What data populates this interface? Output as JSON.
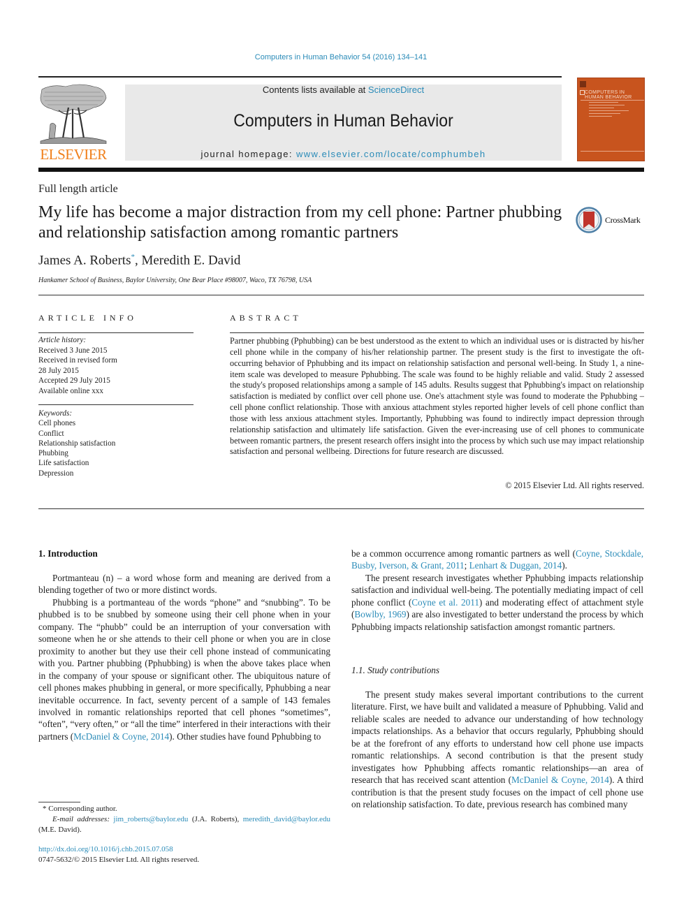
{
  "citation": "Computers in Human Behavior 54 (2016) 134–141",
  "header": {
    "publisher_wordmark": "ELSEVIER",
    "contents_prefix": "Contents lists available at ",
    "contents_link": "ScienceDirect",
    "journal_title": "Computers in Human Behavior",
    "homepage_prefix": "journal homepage: ",
    "homepage_link": "www.elsevier.com/locate/comphumbeh",
    "cover_title_line1": "COMPUTERS IN",
    "cover_title_line2": "HUMAN BEHAVIOR"
  },
  "article": {
    "type": "Full length article",
    "title": "My life has become a major distraction from my cell phone: Partner phubbing and relationship satisfaction among romantic partners",
    "crossmark_label": "CrossMark",
    "author1": "James A. Roberts",
    "author1_mark": "*",
    "author_sep": ", ",
    "author2": "Meredith E. David",
    "affiliation": "Hankamer School of Business, Baylor University, One Bear Place #98007, Waco, TX 76798, USA"
  },
  "article_info": {
    "heading": "ARTICLE INFO",
    "history_label": "Article history:",
    "history": [
      "Received 3 June 2015",
      "Received in revised form",
      "28 July 2015",
      "Accepted 29 July 2015",
      "Available online xxx"
    ],
    "keywords_label": "Keywords:",
    "keywords": [
      "Cell phones",
      "Conflict",
      "Relationship satisfaction",
      "Phubbing",
      "Life satisfaction",
      "Depression"
    ]
  },
  "abstract": {
    "heading": "ABSTRACT",
    "text": "Partner phubbing (Pphubbing) can be best understood as the extent to which an individual uses or is distracted by his/her cell phone while in the company of his/her relationship partner. The present study is the first to investigate the oft-occurring behavior of Pphubbing and its impact on relationship satis­faction and personal well-being. In Study 1, a nine-item scale was developed to measure Pphubbing. The scale was found to be highly reliable and valid. Study 2 assessed the study's proposed relationships among a sample of 145 adults. Results suggest that Pphubbing's impact on relationship satisfaction is mediated by conflict over cell phone use. One's attachment style was found to moderate the Pphubbing – cell phone conflict relationship. Those with anxious attachment styles reported higher levels of cell phone conflict than those with less anxious attachment styles. Importantly, Pphubbing was found to indirectly impact depression through relationship satisfaction and ultimately life satisfaction. Given the ever-increasing use of cell phones to communicate between romantic partners, the present research offers insight into the process by which such use may impact relationship satisfaction and personal well­being. Directions for future research are discussed.",
    "copyright": "© 2015 Elsevier Ltd. All rights reserved."
  },
  "body": {
    "section1_heading": "1.  Introduction",
    "p1": "Portmanteau (n) – a word whose form and meaning are derived from a blending together of two or more distinct words.",
    "p2_a": "Phubbing is a portmanteau of the words “phone” and “snub­bing”. To be phubbed is to be snubbed by someone using their cell phone when in your company. The “phubb” could be an interrup­tion of your conversation with someone when he or she attends to their cell phone or when you are in close proximity to another but they use their cell phone instead of communicating with you. Partner phubbing (Pphubbing) is when the above takes place when in the company of your spouse or significant other. The ubiquitous nature of cell phones makes phubbing in general, or more specif­ically, Pphubbing a near inevitable occurrence. In fact, seventy percent of a sample of 143 females involved in romantic relation­ships reported that cell phones “sometimes”, “often”, “very often,” or “all the time” interfered in their interactions with their partners (",
    "p2_cite": "McDaniel & Coyne, 2014",
    "p2_b": "). Other studies have found Pphubbing to",
    "r1_a": "be a common occurrence among romantic partners as well (",
    "r1_cite1": "Coyne, Stockdale, Busby, Iverson, & Grant, 2011",
    "r1_sep": "; ",
    "r1_cite2": "Lenhart & Duggan, 2014",
    "r1_b": ").",
    "r2_a": "The present research investigates whether Pphubbing impacts relationship satisfaction and individual well-being. The potentially mediating impact of cell phone conflict (",
    "r2_cite1": "Coyne et al. 2011",
    "r2_b": ") and moderating effect of attachment style (",
    "r2_cite2": "Bowlby, 1969",
    "r2_c": ") are also investigated to better understand the process by which Pphubbing impacts relationship satisfaction amongst romantic partners.",
    "subsection_heading": "1.1.  Study contributions",
    "r3_a": "The present study makes several important contributions to the current literature. First, we have built and validated a measure of Pphubbing. Valid and reliable scales are needed to advance our understanding of how technology impacts relationships. As a behavior that occurs regularly, Pphubbing should be at the fore­front of any efforts to understand how cell phone use impacts romantic relationships. A second contribution is that the present study investigates how Pphubbing affects romantic relation­ships—an area of research that has received scant attention (",
    "r3_cite": "McDaniel & Coyne, 2014",
    "r3_b": "). A third contribution is that the present study focuses on the impact of cell phone use on relationship satisfaction. To date, previous research has combined many"
  },
  "footnotes": {
    "corresponding": "* Corresponding author.",
    "email_label": "E-mail addresses: ",
    "email1": "jim_roberts@baylor.edu",
    "email1_owner": " (J.A. Roberts), ",
    "email2": "meredith_david@baylor.edu",
    "email2_owner": " (M.E. David).",
    "doi": "http://dx.doi.org/10.1016/j.chb.2015.07.058",
    "issn": "0747-5632/© 2015 Elsevier Ltd. All rights reserved."
  },
  "colors": {
    "link": "#2a8bb8",
    "elsevier_orange": "#f07f1a",
    "cover_orange": "#c8541e",
    "header_box": "#e9e9e9"
  }
}
